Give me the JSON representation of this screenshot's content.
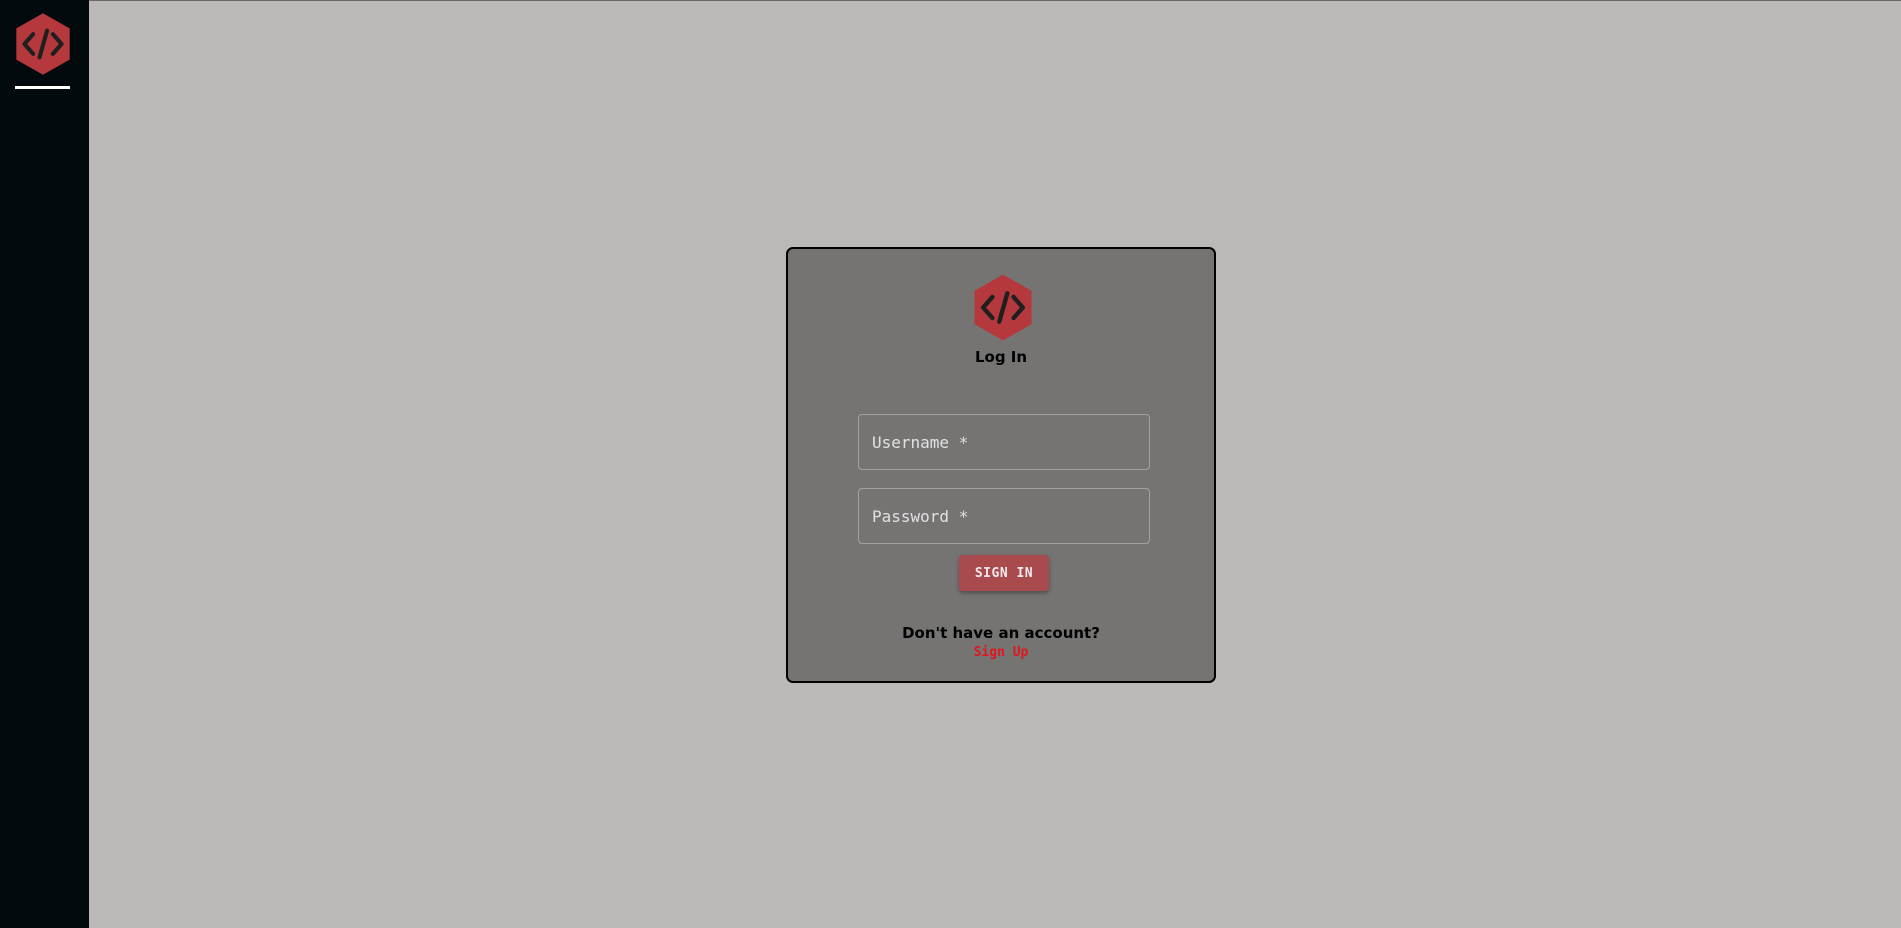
{
  "sidebar": {
    "logo_icon": "code-hexagon-logo",
    "indicator_color": "#ffffff"
  },
  "login_card": {
    "logo_icon": "code-hexagon-logo",
    "title": "Log In",
    "username": {
      "placeholder": "Username *",
      "value": ""
    },
    "password": {
      "placeholder": "Password *",
      "value": ""
    },
    "signin_label": "SIGN IN",
    "signup_prompt": "Don't have an account?",
    "signup_link": "Sign Up"
  },
  "colors": {
    "background": "#bcb8b7",
    "sidebar": "#020a0d",
    "card": "#757473",
    "brand_red": "#b5383d",
    "button": "#a94a4f",
    "link": "#e0161d"
  }
}
